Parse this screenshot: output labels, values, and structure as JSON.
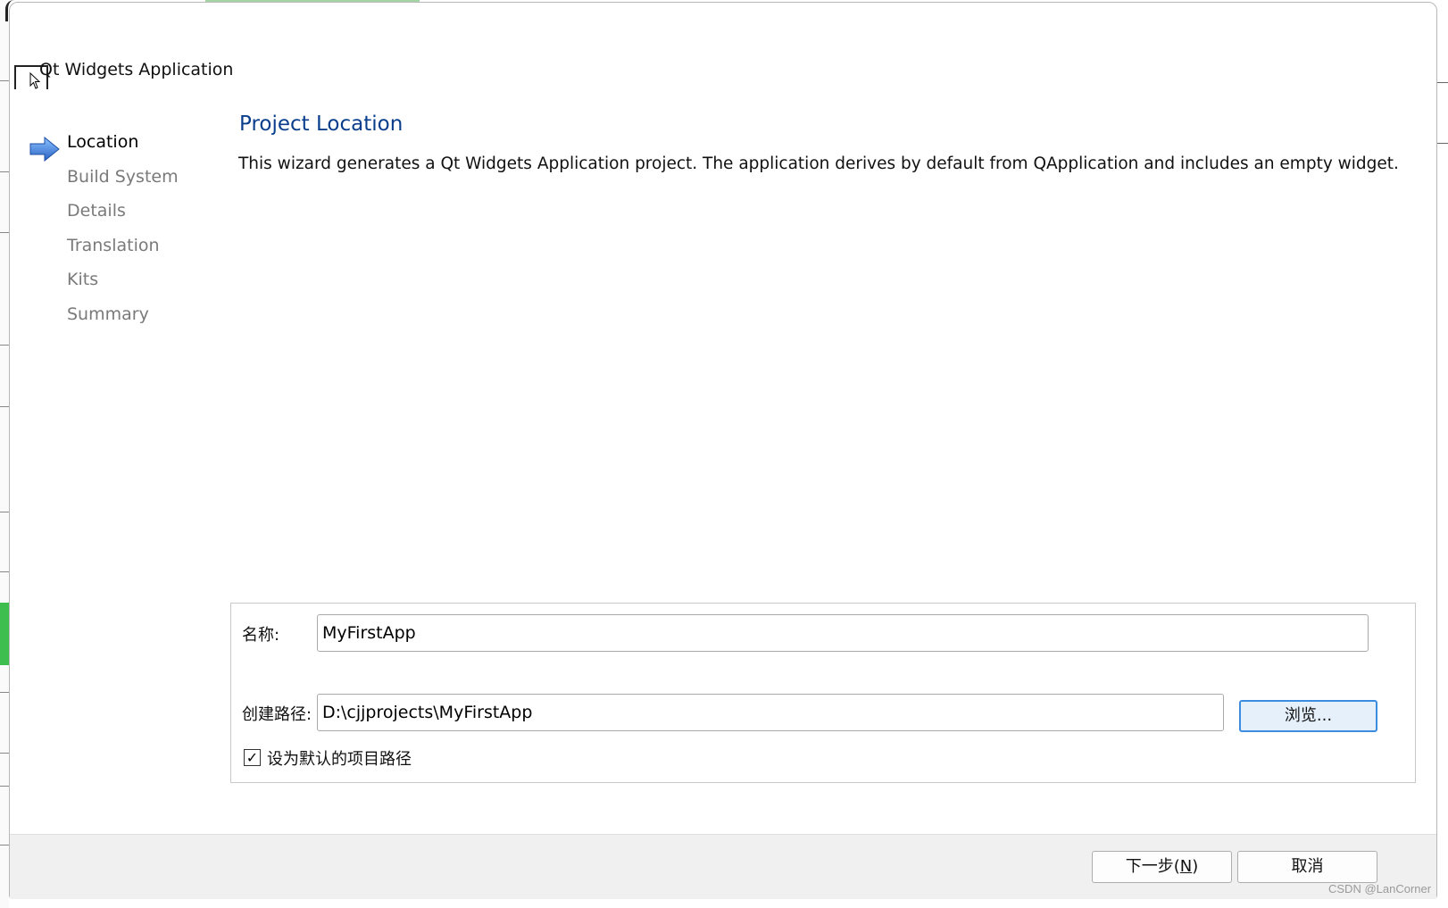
{
  "window": {
    "title": "Qt Widgets Application"
  },
  "steps": [
    {
      "label": "Location",
      "current": true
    },
    {
      "label": "Build System",
      "current": false
    },
    {
      "label": "Details",
      "current": false
    },
    {
      "label": "Translation",
      "current": false
    },
    {
      "label": "Kits",
      "current": false
    },
    {
      "label": "Summary",
      "current": false
    }
  ],
  "page": {
    "title": "Project Location",
    "description": "This wizard generates a Qt Widgets Application project. The application derives by default from QApplication and includes an empty widget."
  },
  "form": {
    "name_label": "名称:",
    "name_value": "MyFirstApp",
    "path_label": "创建路径:",
    "path_value": "D:\\cjjprojects\\MyFirstApp",
    "browse_label": "浏览...",
    "default_path_checkbox": {
      "label": "设为默认的项目路径",
      "checked": true,
      "mark": "✓"
    }
  },
  "footer": {
    "next_label_prefix": "下一步(",
    "next_mnemonic": "N",
    "next_label_suffix": ")",
    "cancel_label": "取消"
  },
  "watermark": "CSDN @LanCorner",
  "icons": {
    "current_step": "right-arrow-icon",
    "window": "window-icon",
    "cursor": "mouse-cursor-icon"
  },
  "colors": {
    "title_blue": "#0a3e8c",
    "step_inactive": "#7a7a7a",
    "browse_border": "#3c8de0",
    "arrow_blue": "#3b7fd9"
  }
}
